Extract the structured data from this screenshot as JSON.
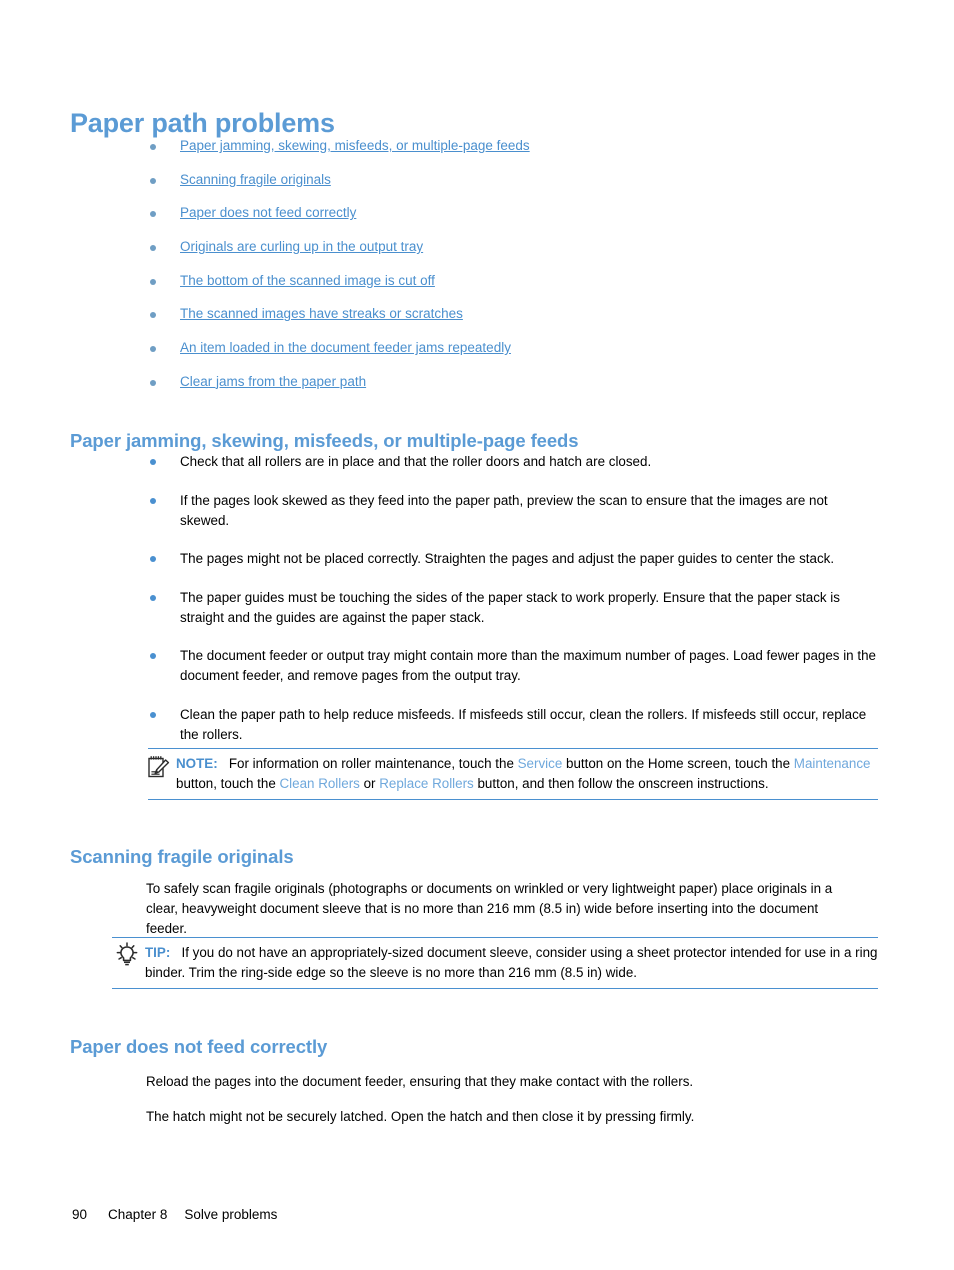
{
  "page": {
    "title": "Paper path problems",
    "footer": {
      "page_number": "90",
      "chapter": "Chapter 8",
      "chapter_title": "Solve problems"
    }
  },
  "toc": {
    "items": [
      {
        "label": "Paper jamming, skewing, misfeeds, or multiple-page feeds"
      },
      {
        "label": "Scanning fragile originals"
      },
      {
        "label": "Paper does not feed correctly"
      },
      {
        "label": "Originals are curling up in the output tray"
      },
      {
        "label": "The bottom of the scanned image is cut off"
      },
      {
        "label": "The scanned images have streaks or scratches"
      },
      {
        "label": "An item loaded in the document feeder jams repeatedly"
      },
      {
        "label": "Clear jams from the paper path"
      }
    ]
  },
  "sections": {
    "jamming": {
      "heading": "Paper jamming, skewing, misfeeds, or multiple-page feeds",
      "bullets": [
        "Check that all rollers are in place and that the roller doors and hatch are closed.",
        "If the pages look skewed as they feed into the paper path, preview the scan to ensure that the images are not skewed.",
        "The pages might not be placed correctly. Straighten the pages and adjust the paper guides to center the stack.",
        "The paper guides must be touching the sides of the paper stack to work properly. Ensure that the paper stack is straight and the guides are against the paper stack.",
        "The document feeder or output tray might contain more than the maximum number of pages. Load fewer pages in the document feeder, and remove pages from the output tray.",
        "Clean the paper path to help reduce misfeeds. If misfeeds still occur, clean the rollers. If misfeeds still occur, replace the rollers."
      ],
      "note": {
        "label": "NOTE:",
        "icon": "note-pad-pencil-icon",
        "text_part_1": "For information on roller maintenance, touch the ",
        "term_1": "Service",
        "text_part_2": " button on the Home screen, touch the ",
        "term_2": "Maintenance",
        "text_part_3": " button, touch the ",
        "term_3": "Clean Rollers",
        "text_part_4": " or ",
        "term_4": "Replace Rollers",
        "text_part_5": " button, and then follow the onscreen instructions."
      }
    },
    "fragile": {
      "heading": "Scanning fragile originals",
      "paragraph": "To safely scan fragile originals (photographs or documents on wrinkled or very lightweight paper) place originals in a clear, heavyweight document sleeve that is no more than 216 mm (8.5 in) wide before inserting into the document feeder.",
      "tip": {
        "label": "TIP:",
        "icon": "lightbulb-icon",
        "text": "If you do not have an appropriately-sized document sleeve, consider using a sheet protector intended for use in a ring binder. Trim the ring-side edge so the sleeve is no more than 216 mm (8.5 in) wide."
      }
    },
    "feed": {
      "heading": "Paper does not feed correctly",
      "paragraph_1": "Reload the pages into the document feeder, ensuring that they make contact with the rollers.",
      "paragraph_2": "The hatch might not be securely latched. Open the hatch and then close it by pressing firmly."
    }
  },
  "colors": {
    "heading_blue": "#5b9bd5",
    "link_blue": "#4a8fce",
    "ui_term_blue": "#6fa8dc",
    "rule_blue": "#4a90d0",
    "bullet_blue": "#4a90d0",
    "text_black": "#000000",
    "background": "#ffffff"
  }
}
